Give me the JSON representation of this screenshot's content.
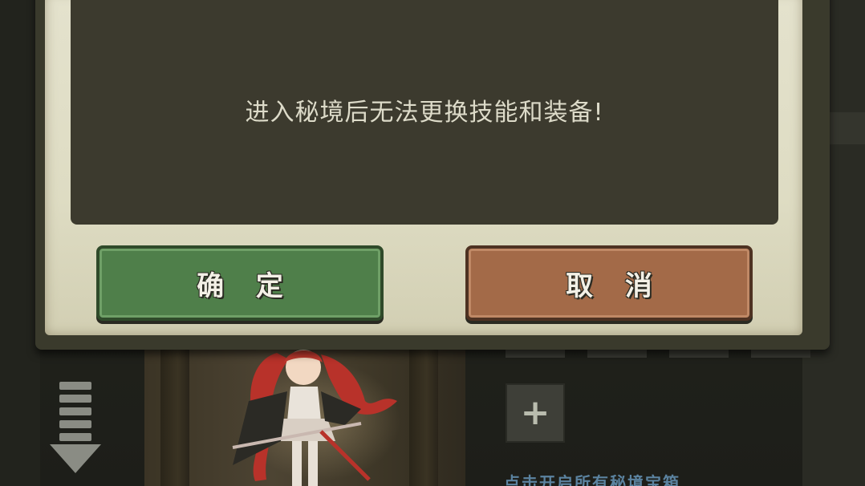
{
  "dialog": {
    "message": "进入秘境后无法更换技能和装备!",
    "confirm_label": "确 定",
    "cancel_label": "取 消"
  },
  "background": {
    "add_slot_symbol": "+",
    "bottom_hint": "点击开启所有秘境宝箱"
  },
  "colors": {
    "confirm_button": "#4f7f4a",
    "cancel_button": "#a36a48",
    "dialog_paper": "#e4e2cd",
    "message_box": "#3c3a2e"
  },
  "icons": [
    "down-arrow-icon",
    "plus-icon"
  ]
}
